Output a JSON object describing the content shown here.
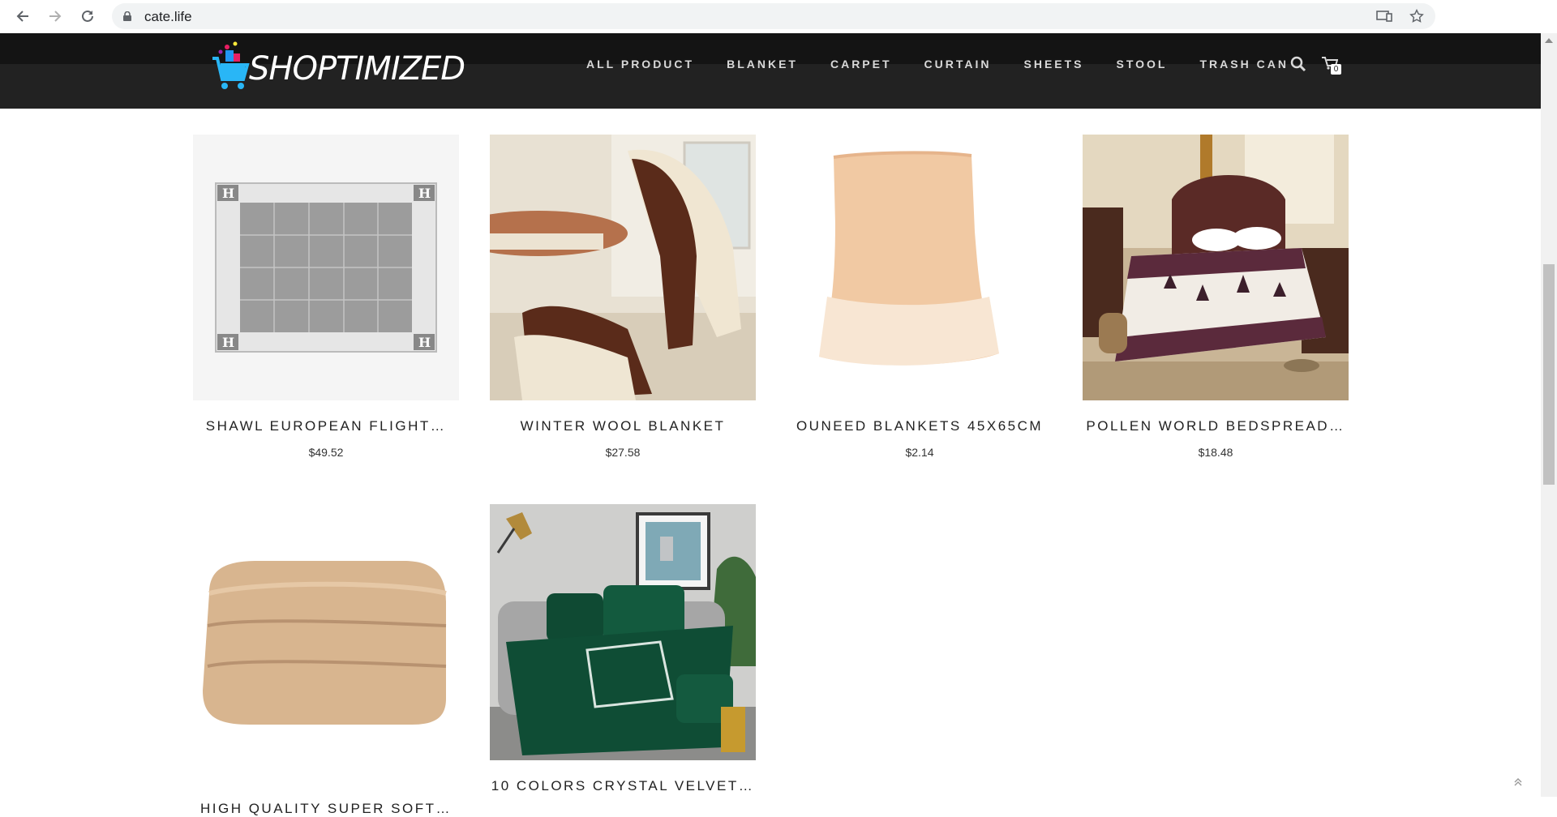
{
  "browser": {
    "url": "cate.life"
  },
  "site": {
    "logo_text": "SHOPTIMIZED",
    "menu": [
      "ALL PRODUCT",
      "BLANKET",
      "CARPET",
      "CURTAIN",
      "SHEETS",
      "STOOL",
      "TRASH CAN"
    ],
    "cart_count": "0"
  },
  "products": [
    {
      "title": "SHAWL EUROPEAN FLIGHT…",
      "price": "$49.52"
    },
    {
      "title": "WINTER WOOL BLANKET",
      "price": "$27.58"
    },
    {
      "title": "OUNEED BLANKETS 45X65CM",
      "price": "$2.14"
    },
    {
      "title": "POLLEN WORLD BEDSPREAD…",
      "price": "$18.48"
    },
    {
      "title": "HIGH QUALITY SUPER SOFT…",
      "price": ""
    },
    {
      "title": "10 COLORS CRYSTAL VELVET…",
      "price": ""
    }
  ],
  "colors": {
    "header_bg": "#222222",
    "header_topband": "#141414",
    "menu_text": "#d9d9d9"
  }
}
